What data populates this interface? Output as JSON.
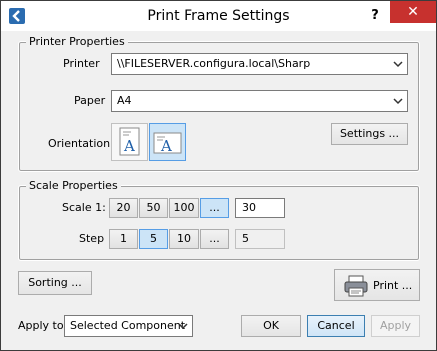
{
  "window": {
    "title": "Print Frame Settings",
    "help": "?",
    "close": "✕"
  },
  "printer_properties": {
    "title": "Printer Properties",
    "printer_label": "Printer",
    "printer_value": "\\\\FILESERVER.configura.local\\Sharp",
    "paper_label": "Paper",
    "paper_value": "A4",
    "orientation_label": "Orientation",
    "orientation_selected": "landscape",
    "settings_button": "Settings ..."
  },
  "scale_properties": {
    "title": "Scale Properties",
    "scale_label": "Scale 1:",
    "scale_options": [
      "20",
      "50",
      "100",
      "..."
    ],
    "scale_selected": "...",
    "scale_value": "30",
    "step_label": "Step",
    "step_options": [
      "1",
      "5",
      "10",
      "..."
    ],
    "step_selected": "5",
    "step_value": "5"
  },
  "sorting_button": "Sorting ...",
  "print_button": "Print ...",
  "apply_to_label": "Apply to",
  "apply_to_value": "Selected Component",
  "ok_button": "OK",
  "cancel_button": "Cancel",
  "apply_button": "Apply",
  "icons": {
    "app": "back-arrow-icon",
    "printer": "printer-icon",
    "portrait": "portrait-page-icon",
    "landscape": "landscape-page-icon"
  }
}
